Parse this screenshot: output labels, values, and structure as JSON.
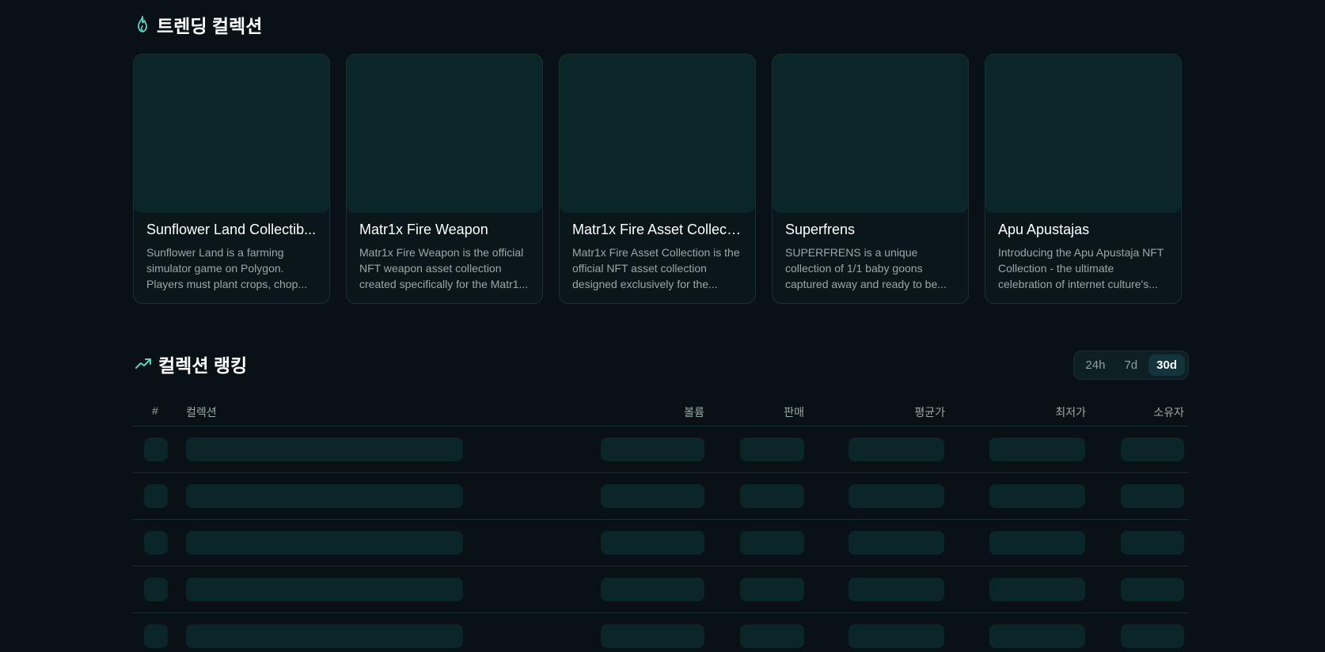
{
  "trending": {
    "title": "트렌딩 컬렉션",
    "icon": "flame-icon",
    "cards": [
      {
        "title": "Sunflower Land Collectib...",
        "description": "Sunflower Land is a farming simulator game on Polygon. Players must plant crops, chop..."
      },
      {
        "title": "Matr1x Fire Weapon",
        "description": "Matr1x Fire Weapon is the official NFT weapon asset collection created specifically for the Matr1..."
      },
      {
        "title": "Matr1x Fire Asset Collect...",
        "description": "Matr1x Fire Asset Collection is the official NFT asset collection designed exclusively for the..."
      },
      {
        "title": "Superfrens",
        "description": "SUPERFRENS is a unique collection of 1/1 baby goons captured away and ready to be..."
      },
      {
        "title": "Apu Apustajas",
        "description": "Introducing the Apu Apustaja NFT Collection - the ultimate celebration of internet culture's..."
      }
    ]
  },
  "ranking": {
    "title": "컬렉션 랭킹",
    "icon": "trending-up-icon",
    "time_filters": [
      "24h",
      "7d",
      "30d"
    ],
    "active_filter": "30d",
    "columns": {
      "rank": "#",
      "collection": "컬렉션",
      "volume": "볼륨",
      "sales": "판매",
      "avg_price": "평균가",
      "floor_price": "최저가",
      "owners": "소유자"
    },
    "loading_rows": 5
  },
  "colors": {
    "background": "#0a1116",
    "accent": "#5fd3c0",
    "skeleton": "#0b2628"
  }
}
